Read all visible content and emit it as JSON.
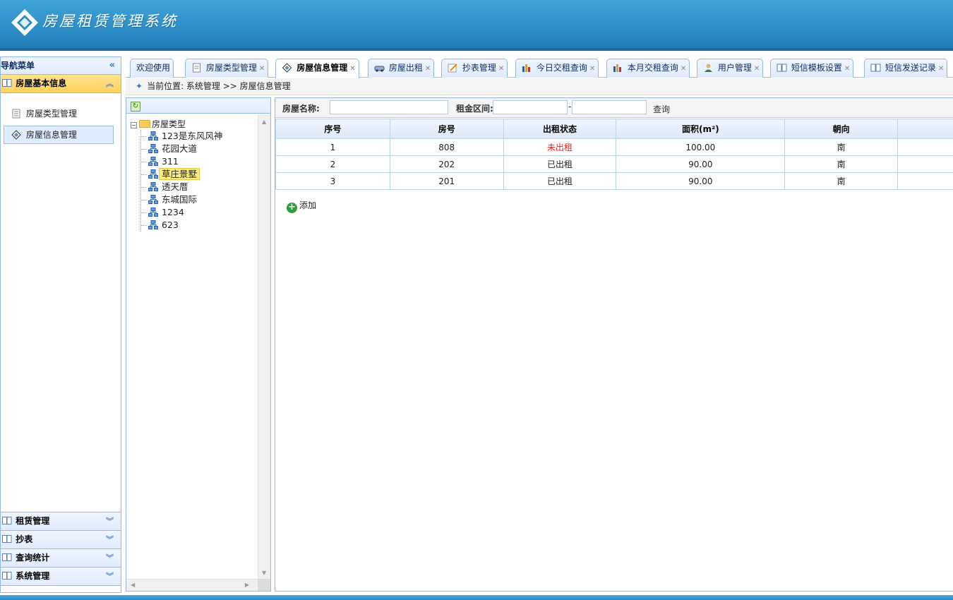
{
  "app": {
    "title": "房屋租赁管理系统"
  },
  "nav": {
    "header": "导航菜单",
    "collapse_glyph": "«",
    "sections": [
      {
        "label": "房屋基本信息",
        "expanded": true
      },
      {
        "label": "租赁管理",
        "expanded": false
      },
      {
        "label": "抄表",
        "expanded": false
      },
      {
        "label": "查询统计",
        "expanded": false
      },
      {
        "label": "系统管理",
        "expanded": false
      }
    ],
    "items": [
      {
        "label": "房屋类型管理",
        "icon": "document-icon"
      },
      {
        "label": "房屋信息管理",
        "icon": "house-icon",
        "selected": true
      }
    ]
  },
  "tabs": [
    {
      "label": "欢迎使用"
    },
    {
      "label": "房屋类型管理"
    },
    {
      "label": "房屋信息管理",
      "active": true
    },
    {
      "label": "房屋出租"
    },
    {
      "label": "抄表管理"
    },
    {
      "label": "今日交租查询"
    },
    {
      "label": "本月交租查询"
    },
    {
      "label": "用户管理"
    },
    {
      "label": "短信模板设置"
    },
    {
      "label": "短信发送记录"
    }
  ],
  "breadcrumb": "当前位置: 系统管理 >> 房屋信息管理",
  "tree": {
    "root": "房屋类型",
    "nodes": [
      "123是东风风神",
      "花园大道",
      "311",
      "草庄景墅",
      "透天厝",
      "东城国际",
      "1234",
      "623"
    ],
    "selected_index": 3
  },
  "search": {
    "name_label": "房屋名称:",
    "name_value": "",
    "rent_label": "租金区间:",
    "rent_min": "",
    "rent_sep": "-",
    "rent_max": "",
    "query_label": "查询"
  },
  "table": {
    "columns": [
      "序号",
      "房号",
      "出租状态",
      "面积(m²)",
      "朝向",
      ""
    ],
    "rows": [
      [
        "1",
        "808",
        "未出租",
        "100.00",
        "南",
        ""
      ],
      [
        "2",
        "202",
        "已出租",
        "90.00",
        "南",
        ""
      ],
      [
        "3",
        "201",
        "已出租",
        "90.00",
        "南",
        ""
      ]
    ],
    "status_colors": {
      "未出租": "#e02020",
      "已出租": "#222222"
    }
  },
  "add_label": "添加",
  "colors": {
    "header_blue": "#2c8dc6",
    "active_section": "#ffd35a",
    "panel_border": "#95b8e7"
  }
}
